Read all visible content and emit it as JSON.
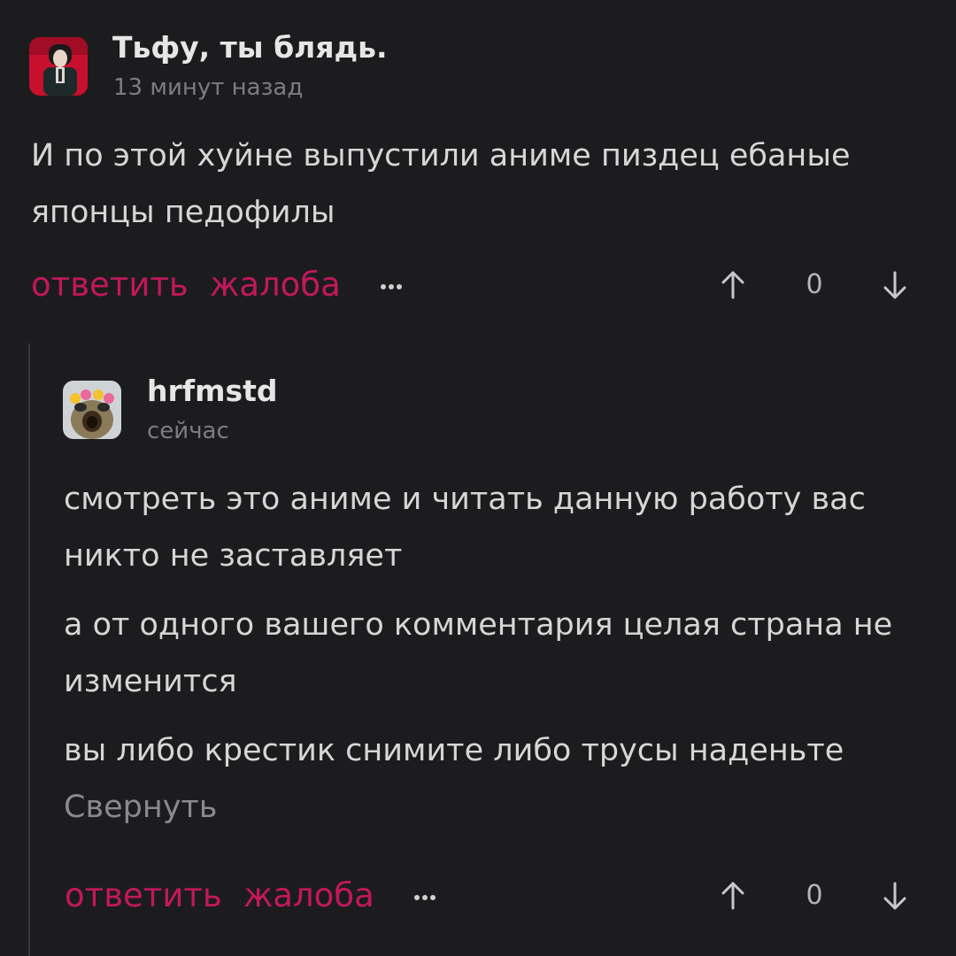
{
  "colors": {
    "background": "#1c1c1e",
    "accent": "#c2185b",
    "muted": "#7d7d80",
    "text": "#d6d6d6"
  },
  "comments": [
    {
      "author": "Тьфу, ты блядь.",
      "time": "13 минут назад",
      "avatar_icon": "user-avatar-icon",
      "paragraphs": [
        "И по этой хуйне выпустили аниме пиздец ебаные японцы педофилы"
      ],
      "actions": {
        "reply": "ответить",
        "report": "жалоба",
        "more_icon": "more-dots-icon"
      },
      "score": "0"
    },
    {
      "author": "hrfmstd",
      "time": "сейчас",
      "avatar_icon": "fish-avatar-icon",
      "paragraphs": [
        "смотреть это аниме и читать данную работу вас никто не заставляет",
        "а от одного вашего комментария целая страна не изменится",
        "вы либо крестик снимите либо трусы наденьте"
      ],
      "collapse": "Свернуть",
      "actions": {
        "reply": "ответить",
        "report": "жалоба",
        "more_icon": "more-dots-icon"
      },
      "score": "0"
    }
  ]
}
